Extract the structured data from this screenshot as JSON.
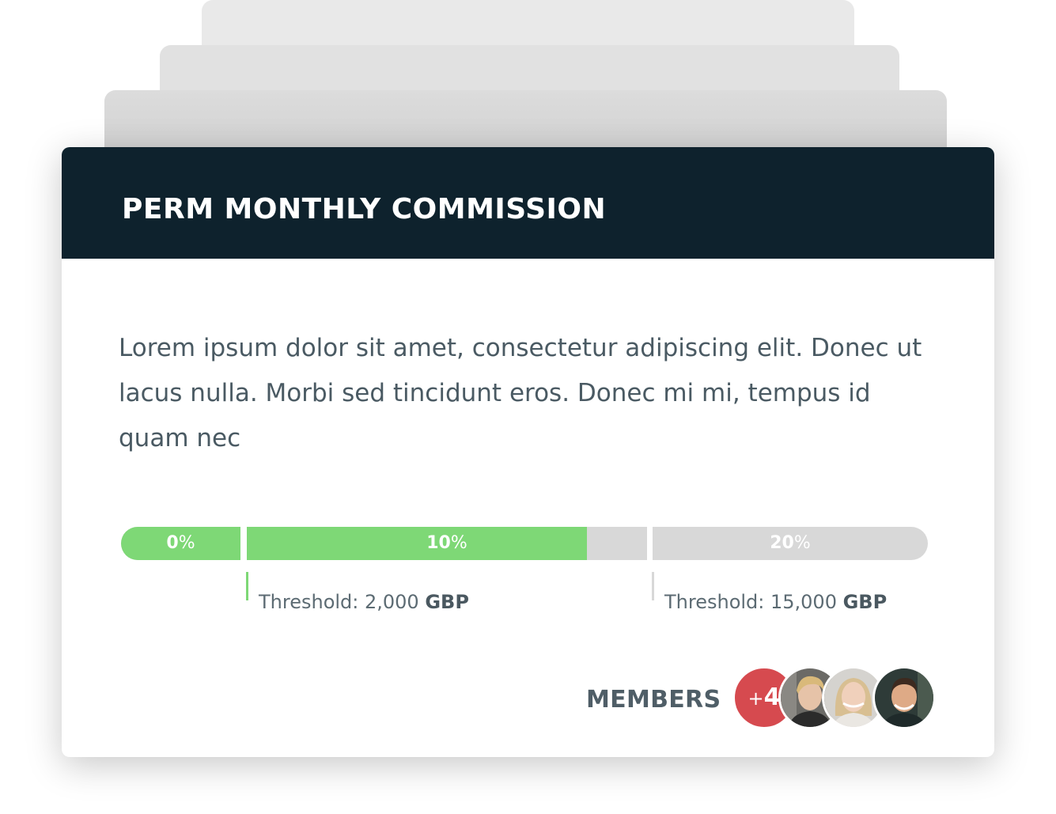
{
  "card": {
    "title": "PERM MONTHLY COMMISSION",
    "description": "Lorem ipsum dolor sit amet, consectetur adipiscing elit. Donec ut lacus nulla. Morbi sed tincidunt eros. Donec mi mi, tempus id quam nec"
  },
  "tiers": [
    {
      "rate": "0",
      "unit": "%",
      "progress": 1.0
    },
    {
      "rate": "10",
      "unit": "%",
      "progress": 0.85
    },
    {
      "rate": "20",
      "unit": "%",
      "progress": 0.0
    }
  ],
  "thresholds": [
    {
      "label": "Threshold: 2,000",
      "currency": "GBP",
      "reached": true
    },
    {
      "label": "Threshold: 15,000",
      "currency": "GBP",
      "reached": false
    }
  ],
  "members": {
    "label": "MEMBERS",
    "more_prefix": "+",
    "more_count": "4",
    "avatars": [
      "member-avatar-1",
      "member-avatar-2",
      "member-avatar-3"
    ]
  },
  "colors": {
    "header_bg": "#0e222d",
    "progress_fill": "#7ed876",
    "progress_track": "#d8d8d8",
    "more_badge": "#d64a4f",
    "tick_reached": "#7ed876",
    "tick_pending": "#d8d8d8"
  }
}
